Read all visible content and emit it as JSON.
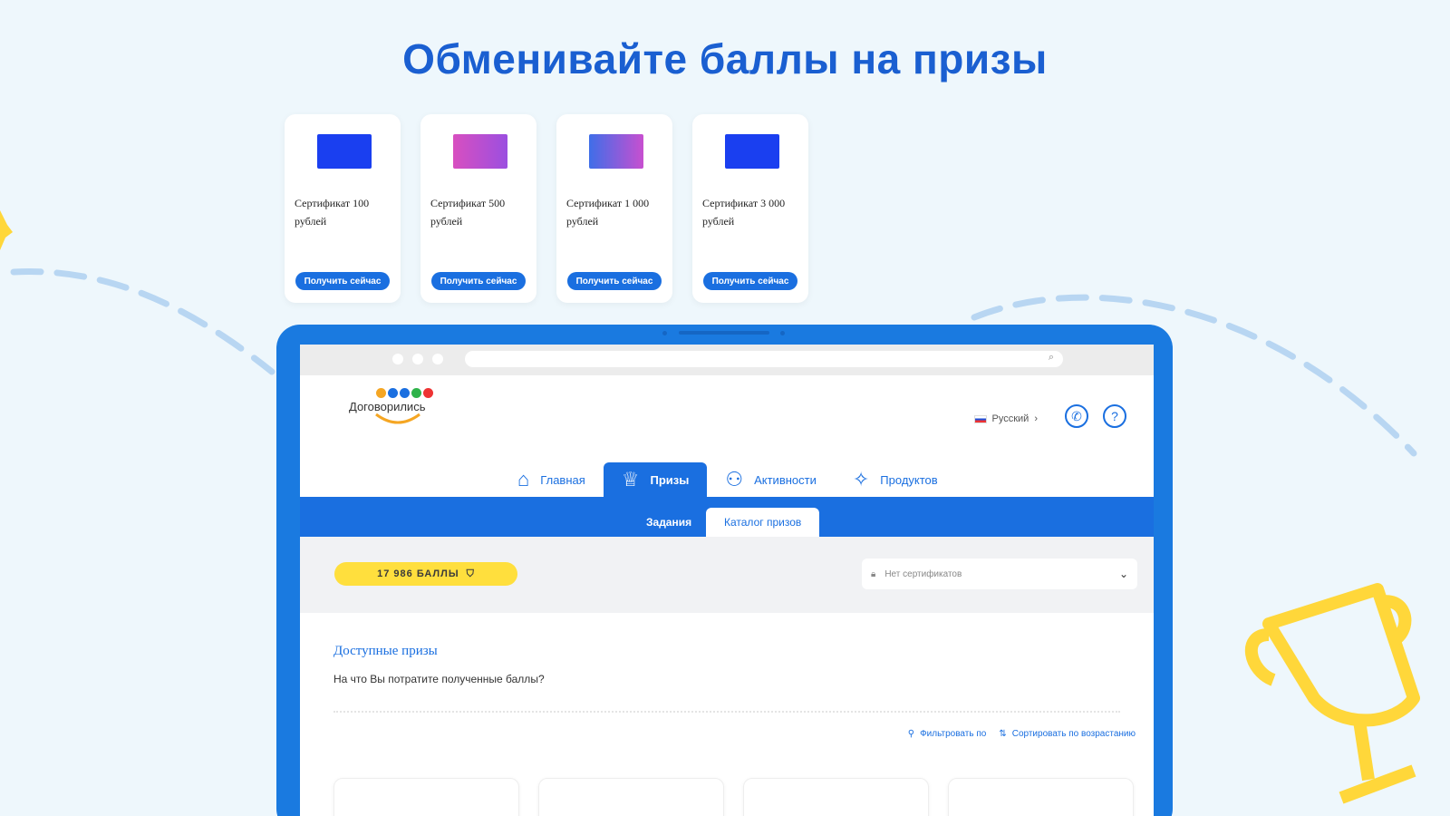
{
  "promo": {
    "title": "Обменивайте баллы на призы"
  },
  "cards": [
    {
      "title": "Сертификат 100 рублей",
      "button": "Получить сейчас",
      "color": "#1a3ff0"
    },
    {
      "title": "Сертификат 500 рублей",
      "button": "Получить сейчас",
      "color": "#c64fd0"
    },
    {
      "title": "Сертификат 1 000 рублей",
      "button": "Получить сейчас",
      "color": "#6a5ce0"
    },
    {
      "title": "Сертификат 3 000 рублей",
      "button": "Получить сейчас",
      "color": "#1a3ff0"
    }
  ],
  "app": {
    "logo_text": "Договорились",
    "language": "Русский",
    "nav": [
      {
        "label": "Главная",
        "icon": "home-icon"
      },
      {
        "label": "Призы",
        "icon": "trophy-icon",
        "active": true
      },
      {
        "label": "Активности",
        "icon": "activity-icon"
      },
      {
        "label": "Продуктов",
        "icon": "products-icon"
      }
    ],
    "subtabs": {
      "tasks": "Задания",
      "catalog": "Каталог призов"
    },
    "points": "17 986 БАЛЛЫ",
    "cert_select": "Нет сертификатов",
    "section_title": "Доступные призы",
    "section_sub": "На что Вы потратите полученные баллы?",
    "filter_label": "Фильтровать по",
    "sort_label": "Сортировать по возрастанию"
  },
  "colors": {
    "brand_blue": "#1a6fe0",
    "points_yellow": "#ffdf3d",
    "title_blue": "#1a5fd1"
  }
}
